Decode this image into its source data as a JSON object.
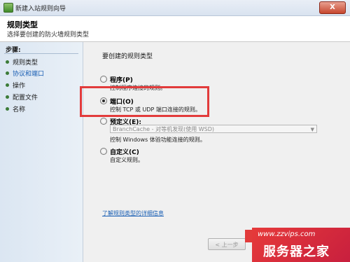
{
  "window": {
    "title": "新建入站规则向导",
    "close_label": "X"
  },
  "header": {
    "title": "规则类型",
    "subtitle": "选择要创建的防火墙规则类型"
  },
  "steps": {
    "title": "步骤:",
    "items": [
      {
        "label": "规则类型"
      },
      {
        "label": "协议和端口"
      },
      {
        "label": "操作"
      },
      {
        "label": "配置文件"
      },
      {
        "label": "名称"
      }
    ]
  },
  "main": {
    "prompt": "要创建的规则类型",
    "options": [
      {
        "label": "程序(P)",
        "desc": "控制程序连接的规则。",
        "checked": false
      },
      {
        "label": "端口(O)",
        "desc": "控制 TCP 或 UDP 端口连接的规则。",
        "checked": true
      },
      {
        "label": "预定义(E):",
        "desc": "控制 Windows 体验功能连接的规则。",
        "checked": false
      },
      {
        "label": "自定义(C)",
        "desc": "自定义规则。",
        "checked": false
      }
    ],
    "predefined_select": {
      "value": "BranchCache - 对等机发现(使用 WSD)"
    },
    "learn_more": "了解规则类型的详细信息"
  },
  "buttons": {
    "prev": "< 上一步"
  },
  "watermark": {
    "url": "www.zzvips.com",
    "brand": "服务器之家"
  },
  "colors": {
    "highlight": "#e23b3b",
    "link": "#1a5fb4",
    "step_dot": "#3c7b37"
  }
}
